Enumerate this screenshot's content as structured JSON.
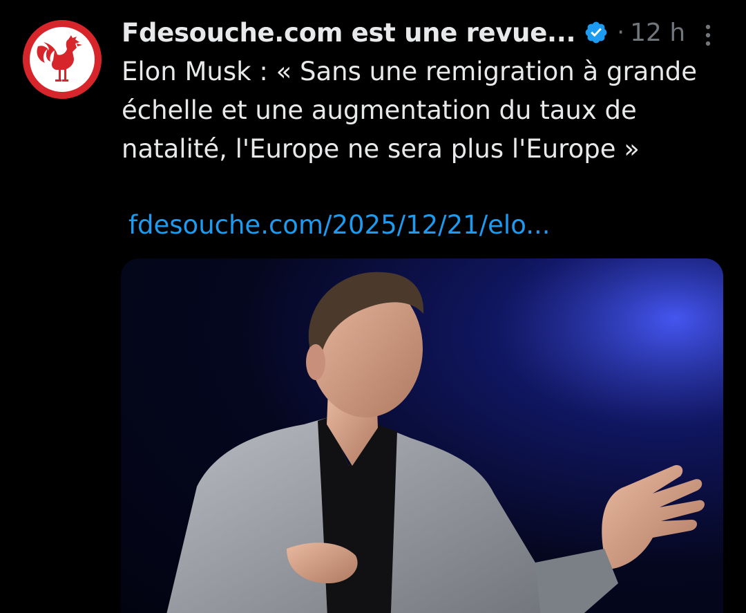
{
  "tweet": {
    "avatar": {
      "icon": "rooster-icon",
      "bg_color": "#d7262b"
    },
    "display_name": "Fdesouche.com est une revue...",
    "verified_icon": "verified-badge-icon",
    "verified_color": "#1d9bf0",
    "separator": "·",
    "timestamp": "12 h",
    "more_icon": "more-vertical-icon",
    "text": "Elon Musk : « Sans une remigration à grande\néchelle et une augmentation du taux de\nnatalité, l'Europe ne sera plus l'Europe »",
    "link": "fdesouche.com/2025/12/21/elo...",
    "link_color": "#1d9bf0",
    "media": {
      "description_icon": "photo-man-in-grey-blazer-icon"
    }
  }
}
